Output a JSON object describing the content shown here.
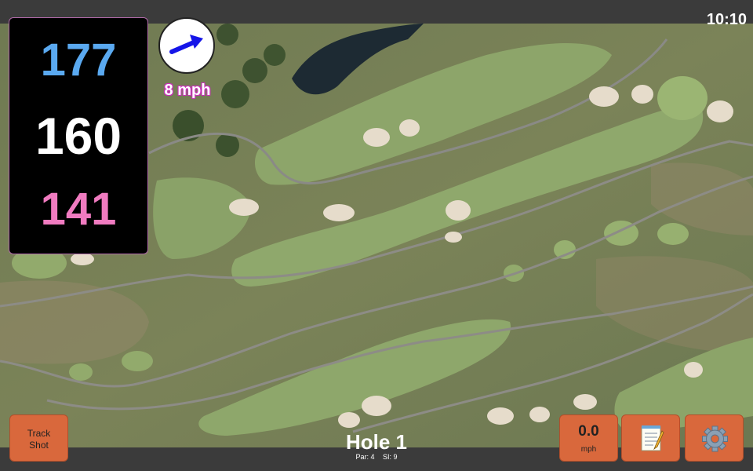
{
  "status_bar": {
    "time": "10:10"
  },
  "distances": {
    "back": "177",
    "middle": "160",
    "front": "141",
    "colors": {
      "back": "#5aa9f0",
      "middle": "#ffffff",
      "front": "#f07bc0"
    }
  },
  "wind": {
    "speed": "8 mph",
    "icon": "arrow-icon",
    "text_color": "#cc2fbd"
  },
  "hole": {
    "title": "Hole 1",
    "par": "Par: 4",
    "si": "SI: 9"
  },
  "buttons": {
    "track_shot": "Track Shot",
    "speed_value": "0.0",
    "speed_unit": "mph",
    "notes_icon": "notepad-icon",
    "settings_icon": "gear-icon"
  },
  "colors": {
    "button_bg": "#d9683c",
    "panel_border": "#b06aa8"
  }
}
